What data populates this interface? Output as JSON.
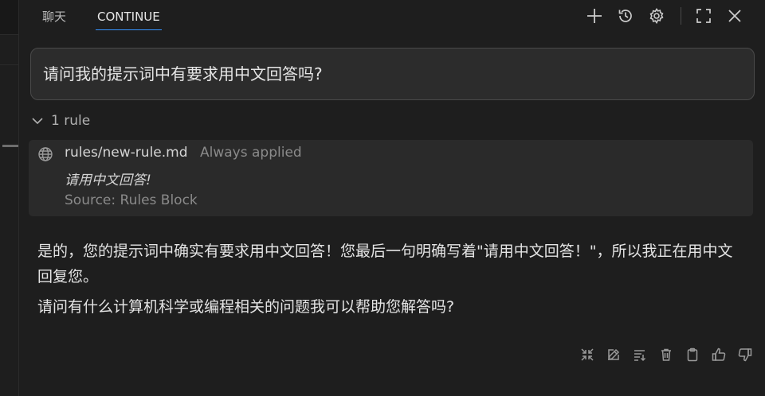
{
  "header": {
    "tabs": [
      {
        "label": "聊天"
      },
      {
        "label": "CONTINUE"
      }
    ],
    "icons": [
      "plus-icon",
      "history-icon",
      "gear-icon",
      "fullscreen-icon",
      "close-icon"
    ]
  },
  "prompt": {
    "text": "请问我的提示词中有要求用中文回答吗?"
  },
  "rules": {
    "toggle_label": "1 rule",
    "items": [
      {
        "name": "rules/new-rule.md",
        "status": "Always applied",
        "text": "请用中文回答!",
        "source": "Source: Rules Block"
      }
    ]
  },
  "answer": {
    "paragraphs": [
      "是的，您的提示词中确实有要求用中文回答！您最后一句明确写着\"请用中文回答！\"，所以我正在用中文回复您。",
      "请问有什么计算机科学或编程相关的问题我可以帮助您解答吗?"
    ]
  },
  "actions": [
    "collapse-icon",
    "edit-icon",
    "wrap-icon",
    "trash-icon",
    "clipboard-icon",
    "thumbs-up-icon",
    "thumbs-down-icon"
  ]
}
